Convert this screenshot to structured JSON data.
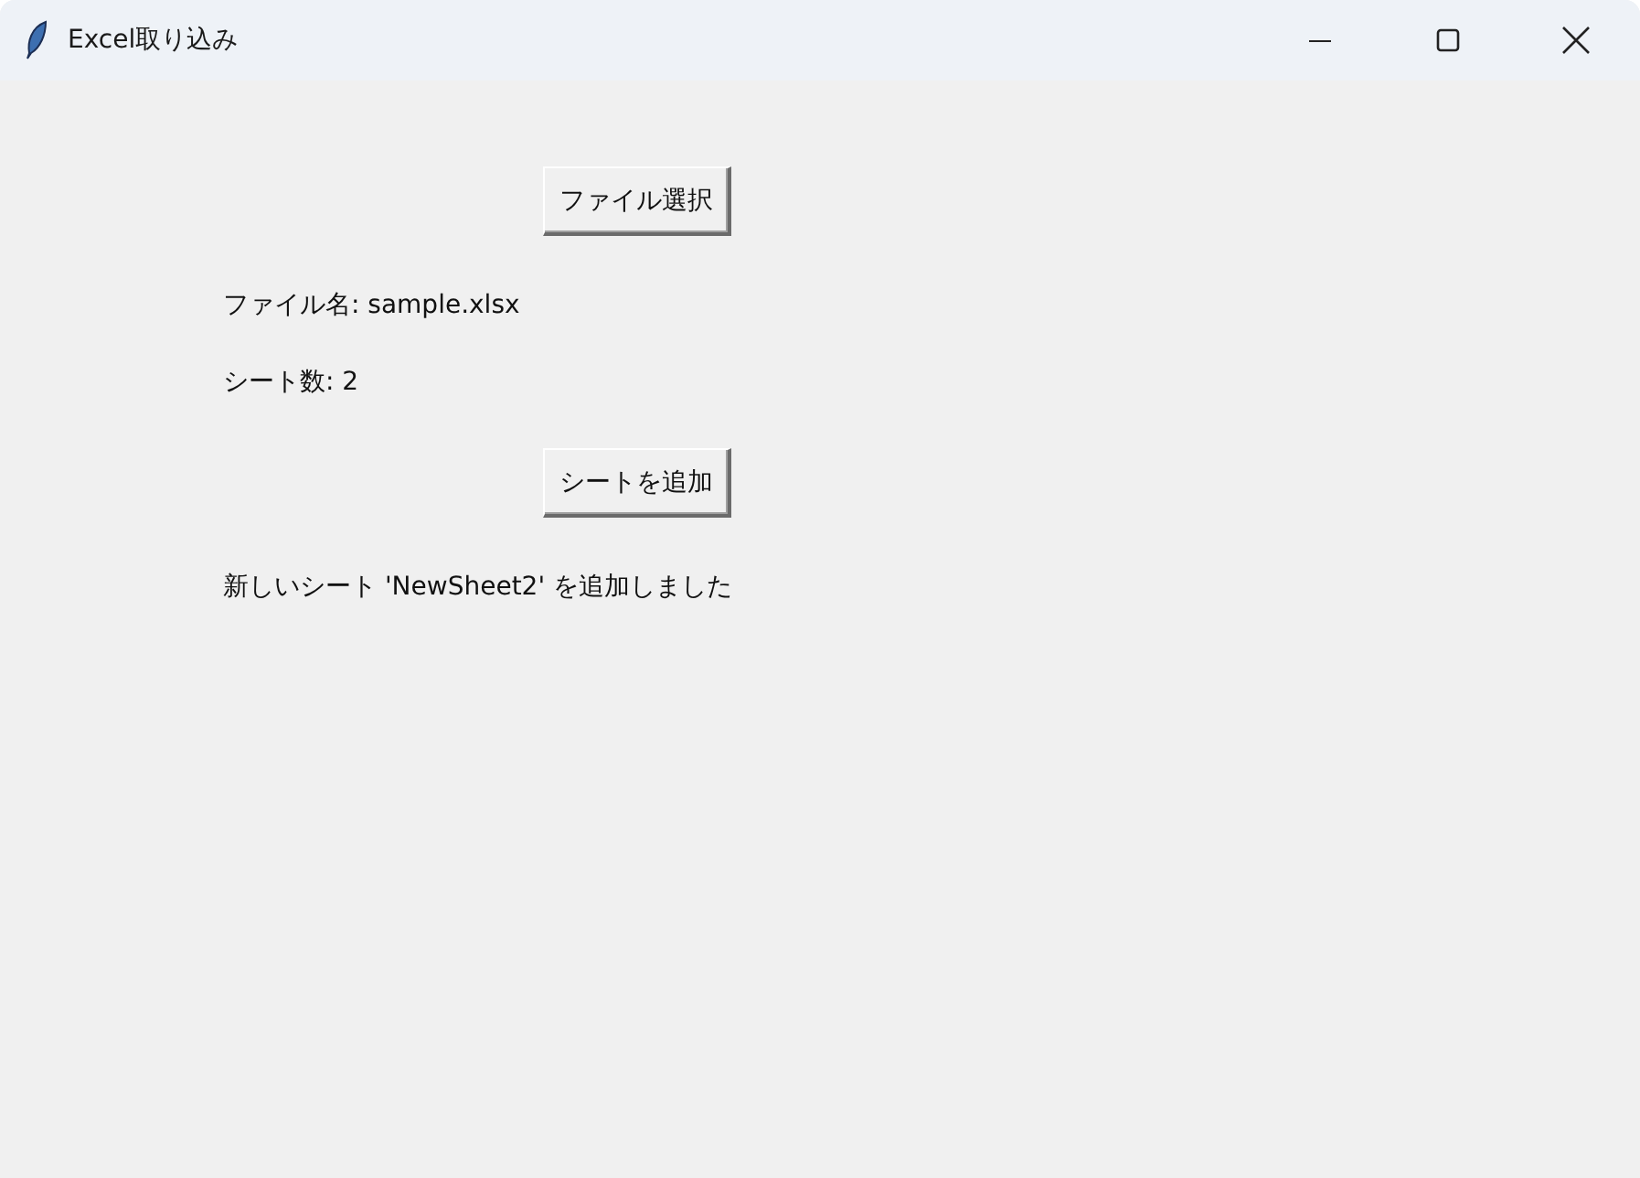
{
  "window": {
    "title": "Excel取り込み"
  },
  "items": [
    {
      "kind": "button",
      "text": "ファイル選択"
    },
    {
      "kind": "label",
      "text": "ファイル名: sample.xlsx"
    },
    {
      "kind": "label",
      "text": "シート数: 2"
    },
    {
      "kind": "button",
      "text": "シートを追加"
    },
    {
      "kind": "label",
      "text": "新しいシート 'NewSheet2' を追加しました"
    }
  ]
}
